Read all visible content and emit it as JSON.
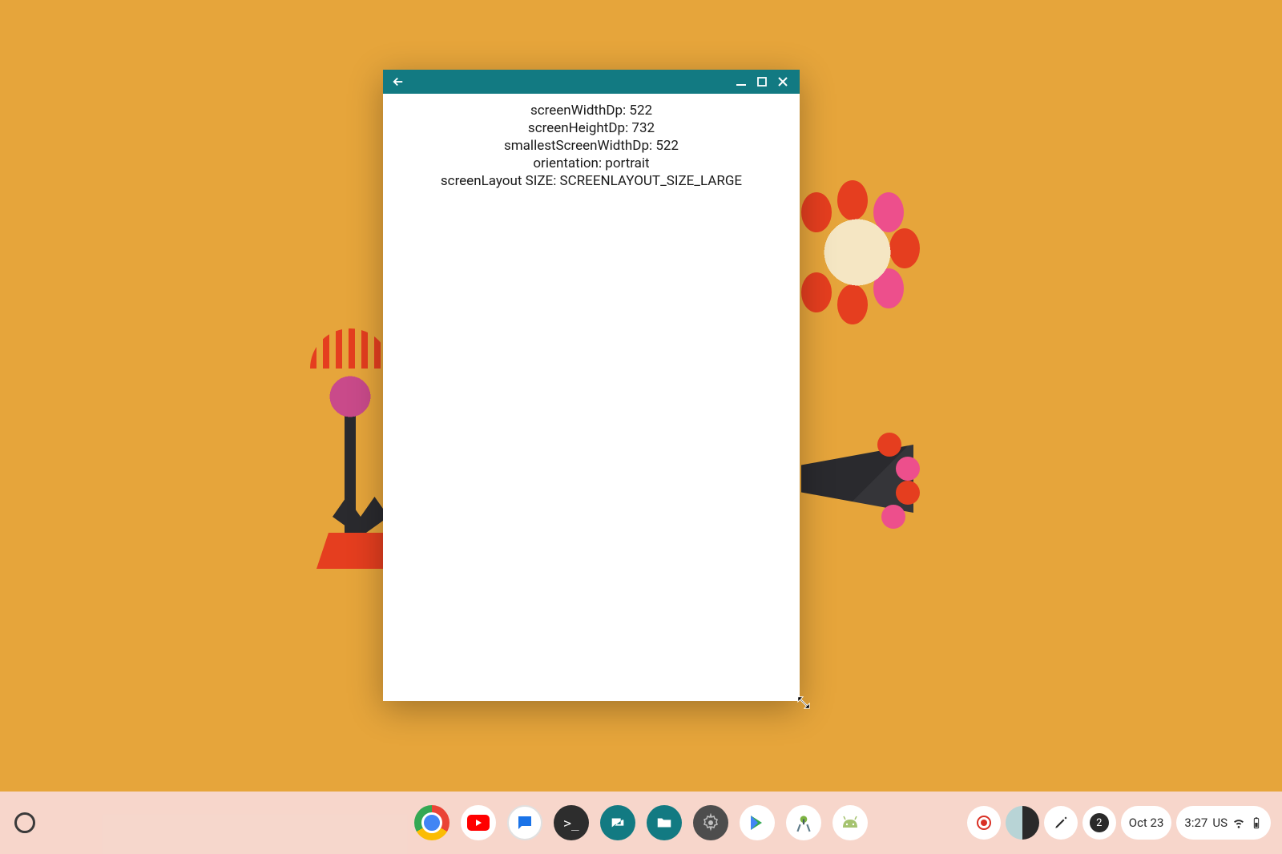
{
  "app": {
    "lines": [
      "screenWidthDp: 522",
      "screenHeightDp: 732",
      "smallestScreenWidthDp: 522",
      "orientation: portrait",
      "screenLayout SIZE: SCREENLAYOUT_SIZE_LARGE"
    ]
  },
  "shelf": {
    "notifications_count": "2",
    "date": "Oct 23",
    "time": "3:27",
    "input": "US"
  }
}
